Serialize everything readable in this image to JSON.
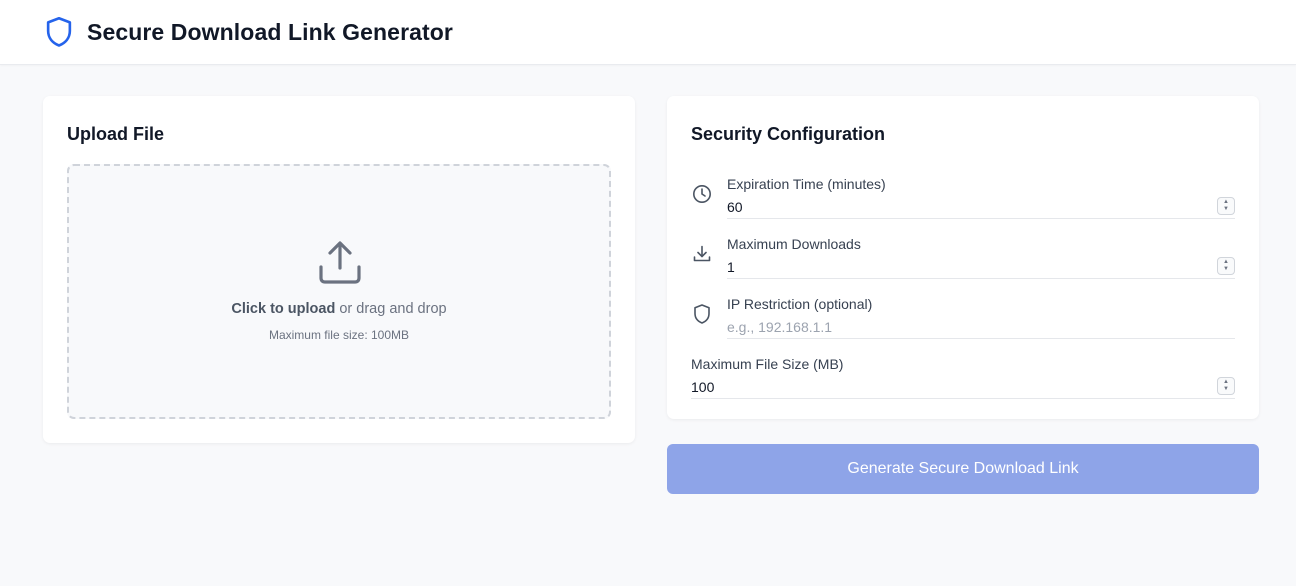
{
  "header": {
    "title": "Secure Download Link Generator",
    "logo_icon": "shield-icon",
    "accent_color": "#2563eb"
  },
  "upload": {
    "heading": "Upload File",
    "icon": "upload-icon",
    "click_text": "Click to upload",
    "drag_text": " or drag and drop",
    "max_size_text": "Maximum file size: 100MB"
  },
  "security": {
    "heading": "Security Configuration",
    "expiration": {
      "label": "Expiration Time (minutes)",
      "value": "60",
      "icon": "clock-icon"
    },
    "max_downloads": {
      "label": "Maximum Downloads",
      "value": "1",
      "icon": "download-icon"
    },
    "ip_restriction": {
      "label": "IP Restriction (optional)",
      "value": "",
      "placeholder": "e.g., 192.168.1.1",
      "icon": "shield-icon"
    },
    "max_file_size": {
      "label": "Maximum File Size (MB)",
      "value": "100"
    }
  },
  "generate_button": {
    "label": "Generate Secure Download Link",
    "color": "#8ea4e8",
    "disabled": true
  }
}
